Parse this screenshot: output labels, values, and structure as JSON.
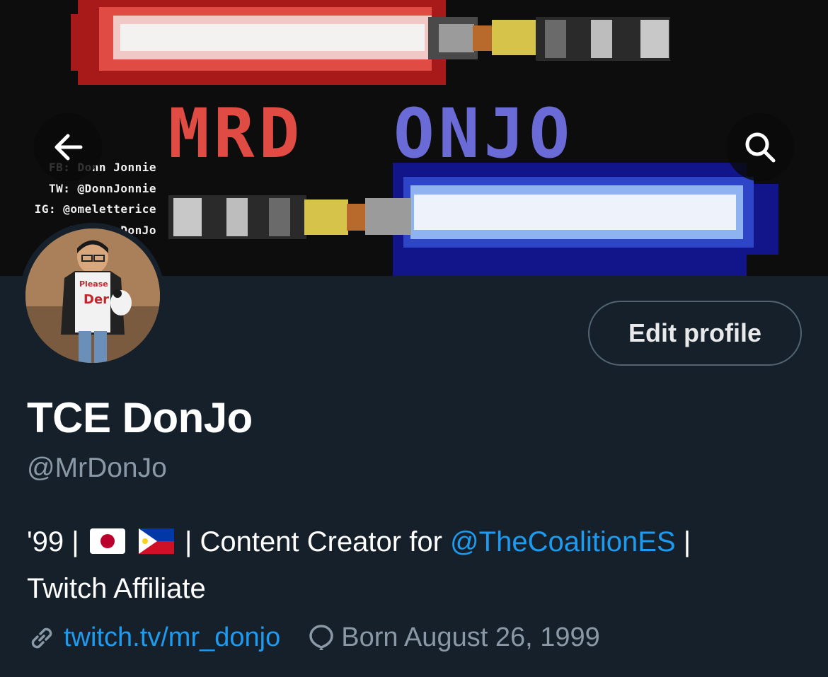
{
  "banner": {
    "logo_text": "MRDONJO",
    "social_lines": [
      "FB: Donn Jonnie",
      "TW: @DonnJonnie",
      "IG: @omeletterice",
      "YT: Mr DonJo"
    ]
  },
  "nav": {
    "back_icon": "arrow-left-icon",
    "search_icon": "search-icon"
  },
  "profile": {
    "edit_label": "Edit profile",
    "display_name": "TCE DonJo",
    "handle": "@MrDonJo",
    "bio_prefix": "'99 |",
    "bio_middle": "| Content Creator for",
    "bio_mention": "@TheCoalitionES",
    "bio_suffix": "|",
    "bio_line2": "Twitch Affiliate",
    "website": "twitch.tv/mr_donjo",
    "birthday": "Born August 26, 1999"
  },
  "colors": {
    "background": "#15202b",
    "accent": "#1d9bf0",
    "secondary_text": "#8b98a5",
    "border": "#536471"
  }
}
